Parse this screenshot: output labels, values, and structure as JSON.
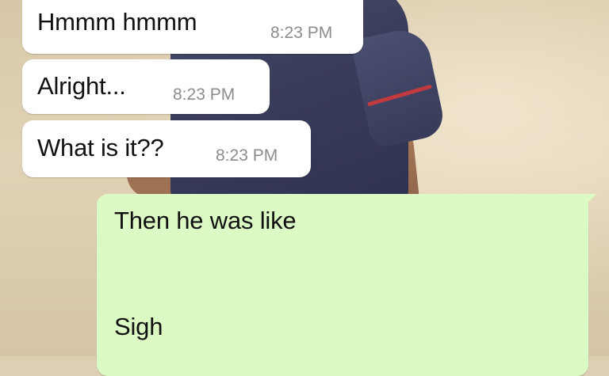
{
  "chat": {
    "incoming": [
      {
        "text": "Hmmm hmmm",
        "time": "8:23 PM"
      },
      {
        "text": "Alright...",
        "time": "8:23 PM"
      },
      {
        "text": "What is it??",
        "time": "8:23 PM"
      }
    ],
    "outgoing": {
      "line1": "Then he was like",
      "line2": "Sigh"
    }
  },
  "colors": {
    "incoming_bubble": "#ffffff",
    "outgoing_bubble": "#dbfac4",
    "timestamp": "#8c8c8c",
    "wallpaper": "#dccfb3"
  }
}
